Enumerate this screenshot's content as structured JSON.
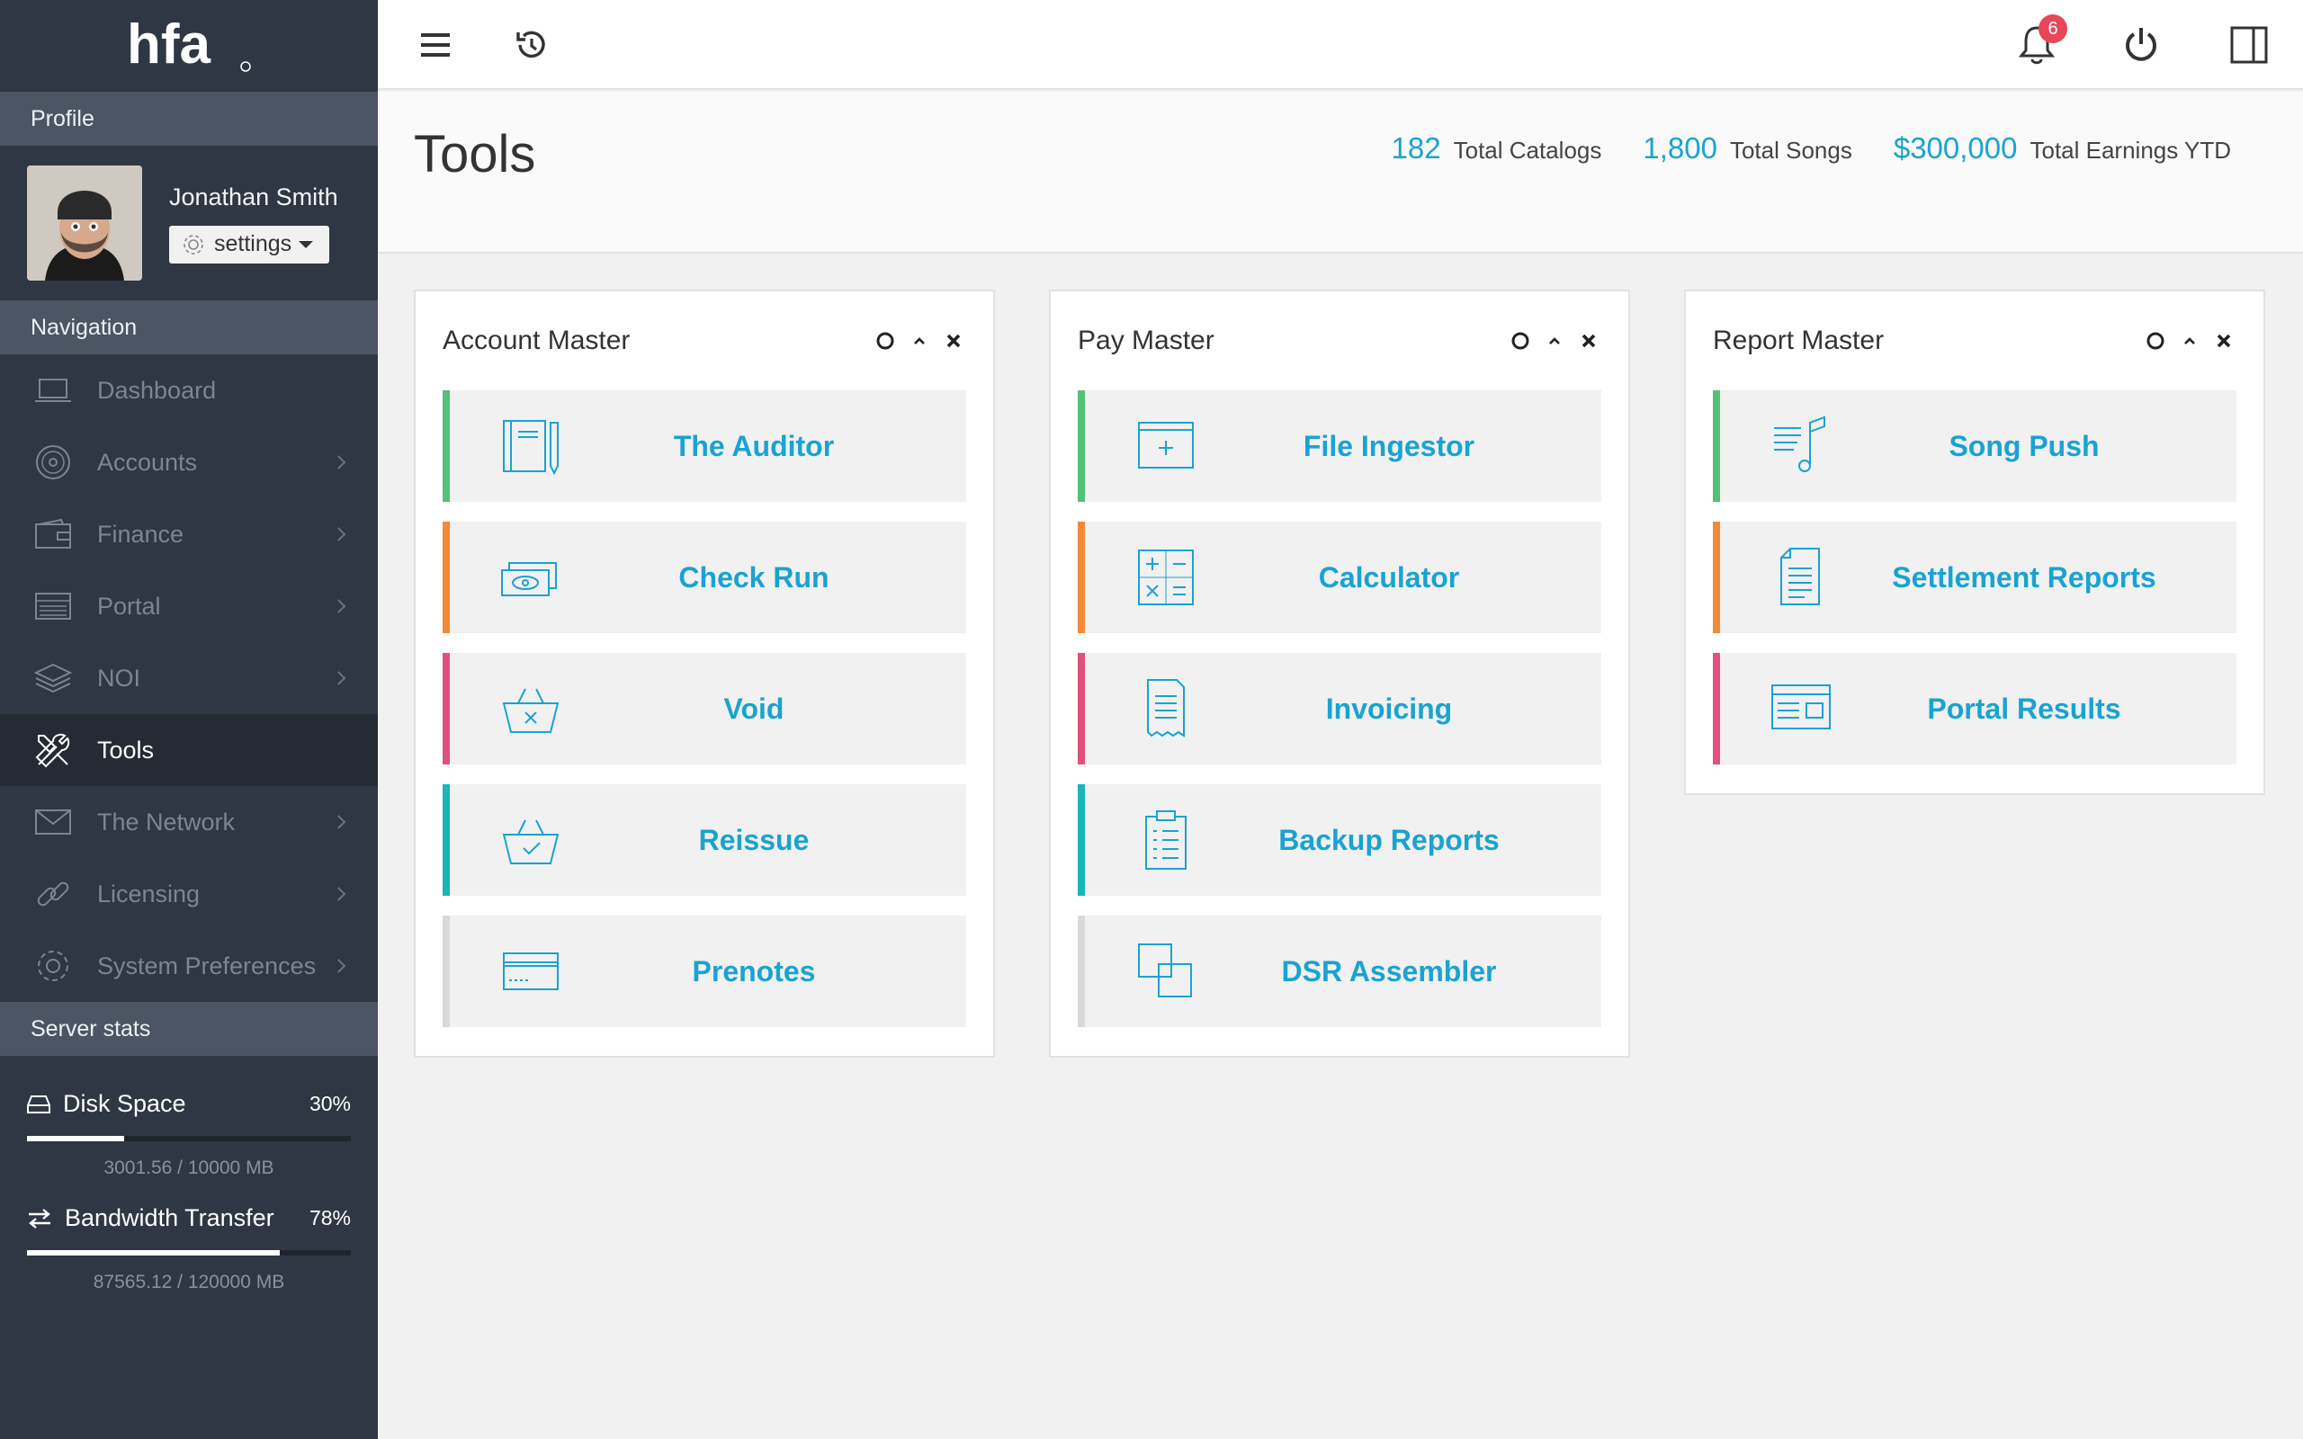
{
  "brand": {
    "logo_text": "hfa"
  },
  "sidebar": {
    "profile_heading": "Profile",
    "user_name": "Jonathan Smith",
    "settings_label": "settings",
    "navigation_heading": "Navigation",
    "nav": [
      {
        "label": "Dashboard",
        "icon": "laptop-icon"
      },
      {
        "label": "Accounts",
        "icon": "vinyl-record-icon"
      },
      {
        "label": "Finance",
        "icon": "wallet-icon"
      },
      {
        "label": "Portal",
        "icon": "list-window-icon"
      },
      {
        "label": "NOI",
        "icon": "layers-icon"
      },
      {
        "label": "Tools",
        "icon": "tools-icon",
        "active": true
      },
      {
        "label": "The Network",
        "icon": "envelope-icon"
      },
      {
        "label": "Licensing",
        "icon": "link-icon"
      },
      {
        "label": "System Preferences",
        "icon": "gear-icon"
      }
    ],
    "server_stats_heading": "Server stats",
    "stats": [
      {
        "label": "Disk Space",
        "percent_text": "30%",
        "fraction": 0.3,
        "detail": "3001.56 / 10000 MB"
      },
      {
        "label": "Bandwidth Transfer",
        "percent_text": "78%",
        "fraction": 0.78,
        "detail": "87565.12 / 120000 MB"
      }
    ]
  },
  "topbar": {
    "notification_count": "6"
  },
  "header": {
    "title": "Tools",
    "summary": [
      {
        "value": "182",
        "label": "Total Catalogs"
      },
      {
        "value": "1,800",
        "label": "Total Songs"
      },
      {
        "value": "$300,000",
        "label": "Total Earnings YTD"
      }
    ]
  },
  "accent_colors": {
    "green": "#52c276",
    "orange": "#f28a3a",
    "pink": "#e2507d",
    "teal": "#1bb4b8",
    "gray": "#d9d9d9"
  },
  "panels": [
    {
      "title": "Account Master",
      "tools": [
        {
          "label": "The Auditor",
          "icon": "notebook-pen-icon",
          "accent": "#52c276"
        },
        {
          "label": "Check Run",
          "icon": "money-icon",
          "accent": "#f28a3a"
        },
        {
          "label": "Void",
          "icon": "basket-x-icon",
          "accent": "#e2507d"
        },
        {
          "label": "Reissue",
          "icon": "basket-check-icon",
          "accent": "#1bb4b8"
        },
        {
          "label": "Prenotes",
          "icon": "card-icon",
          "accent": "#d9d9d9"
        }
      ]
    },
    {
      "title": "Pay Master",
      "tools": [
        {
          "label": "File Ingestor",
          "icon": "window-plus-icon",
          "accent": "#52c276"
        },
        {
          "label": "Calculator",
          "icon": "calculator-icon",
          "accent": "#f28a3a"
        },
        {
          "label": "Invoicing",
          "icon": "receipt-icon",
          "accent": "#e2507d"
        },
        {
          "label": "Backup Reports",
          "icon": "clipboard-icon",
          "accent": "#1bb4b8"
        },
        {
          "label": "DSR Assembler",
          "icon": "overlap-squares-icon",
          "accent": "#d9d9d9"
        }
      ]
    },
    {
      "title": "Report Master",
      "tools": [
        {
          "label": "Song Push",
          "icon": "music-list-icon",
          "accent": "#52c276"
        },
        {
          "label": "Settlement Reports",
          "icon": "document-icon",
          "accent": "#f28a3a"
        },
        {
          "label": "Portal Results",
          "icon": "browser-window-icon",
          "accent": "#e2507d"
        }
      ]
    }
  ]
}
